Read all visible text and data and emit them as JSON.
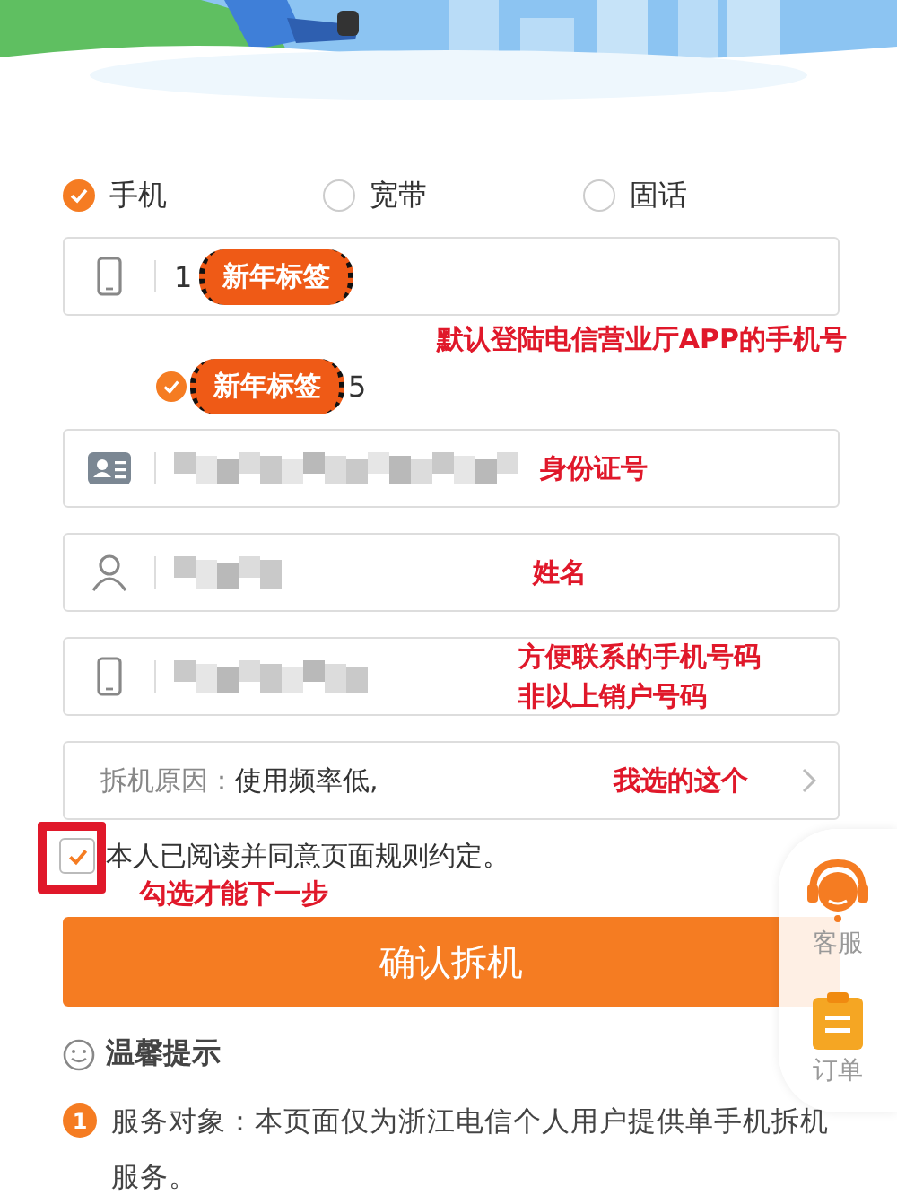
{
  "service_types": [
    {
      "label": "手机",
      "selected": true
    },
    {
      "label": "宽带",
      "selected": false
    },
    {
      "label": "固话",
      "selected": false
    }
  ],
  "phone_field": {
    "value": "1",
    "sticker": "新年标签",
    "note": "默认登陆电信营业厅APP的手机号"
  },
  "number_option": {
    "checked": true,
    "sticker": "新年标签",
    "value_tail": "5"
  },
  "fields": [
    {
      "kind": "id_card",
      "note": [
        "身份证号"
      ]
    },
    {
      "kind": "person",
      "note": [
        "姓名"
      ]
    },
    {
      "kind": "phone",
      "note": [
        "方便联系的手机号码",
        "非以上销户号码"
      ]
    }
  ],
  "reason": {
    "label": "拆机原因：",
    "value": "使用频率低,",
    "note": "我选的这个"
  },
  "agreement": {
    "checked": true,
    "text": "本人已阅读并同意页面规则约定。",
    "note": "勾选才能下一步"
  },
  "confirm_button": "确认拆机",
  "tips": {
    "title": "温馨提示",
    "items": [
      {
        "number": "1",
        "text": "服务对象：本页面仅为浙江电信个人用户提供单手机拆机服务。"
      }
    ]
  },
  "float_menu": [
    {
      "kind": "service",
      "label": "客服"
    },
    {
      "kind": "order",
      "label": "订单"
    }
  ]
}
